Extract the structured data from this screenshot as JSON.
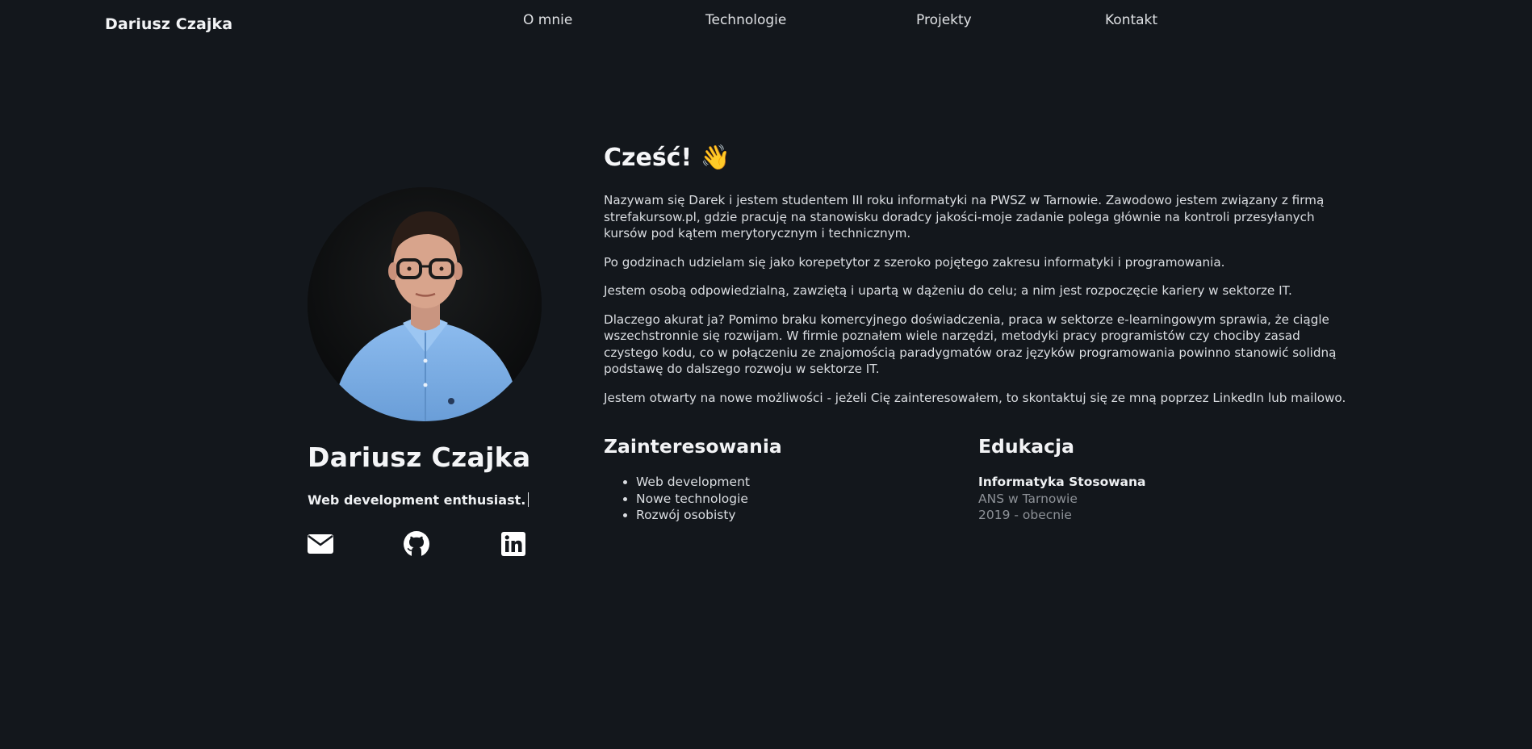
{
  "navbar": {
    "brand": "Dariusz Czajka",
    "links": [
      "O mnie",
      "Technologie",
      "Projekty",
      "Kontakt"
    ]
  },
  "profile": {
    "name": "Dariusz Czajka",
    "tagline": "Web development enthusiast.",
    "photo_icon": "profile-photo",
    "social": [
      {
        "icon": "envelope-icon"
      },
      {
        "icon": "github-icon"
      },
      {
        "icon": "linkedin-icon"
      }
    ]
  },
  "about": {
    "greeting": "Cześć! 👋",
    "paragraphs": [
      "Nazywam się Darek i jestem studentem III roku informatyki na PWSZ w Tarnowie. Zawodowo jestem związany z firmą strefakursow.pl, gdzie pracuję na stanowisku doradcy jakości-moje zadanie polega głównie na kontroli przesyłanych kursów pod kątem merytorycznym i technicznym.",
      "Po godzinach udzielam się jako korepetytor z szeroko pojętego zakresu informatyki i programowania.",
      "Jestem osobą odpowiedzialną, zawziętą i upartą w dążeniu do celu; a nim jest rozpoczęcie kariery w sektorze IT.",
      "Dlaczego akurat ja? Pomimo braku komercyjnego doświadczenia, praca w sektorze e-learningowym sprawia, że ciągle wszechstronnie się rozwijam. W firmie poznałem wiele narzędzi, metodyki pracy programistów czy chociby zasad czystego kodu, co w połączeniu ze znajomością paradygmatów oraz języków programowania powinno stanowić solidną podstawę do dalszego rozwoju w sektorze IT.",
      "Jestem otwarty na nowe możliwości - jeżeli Cię zainteresowałem, to skontaktuj się ze mną poprzez LinkedIn lub mailowo."
    ]
  },
  "interests": {
    "title": "Zainteresowania",
    "items": [
      "Web development",
      "Nowe technologie",
      "Rozwój osobisty"
    ]
  },
  "education": {
    "title": "Edukacja",
    "degree": "Informatyka Stosowana",
    "school": "ANS w Tarnowie",
    "years": "2019 - obecnie"
  },
  "colors": {
    "background": "#13171c",
    "text": "#e6e8eb",
    "muted": "#8d9197",
    "shirt": "#7fb0e6"
  }
}
